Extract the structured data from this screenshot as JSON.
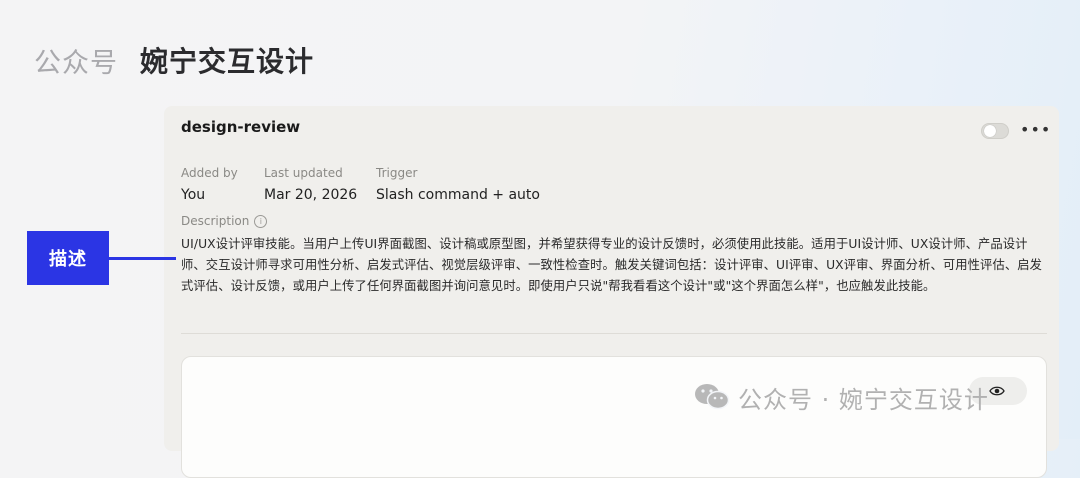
{
  "header": {
    "prefix": "公众号",
    "account": "婉宁交互设计"
  },
  "card": {
    "title": "design-review",
    "meta": [
      {
        "label": "Added by",
        "value": "You"
      },
      {
        "label": "Last updated",
        "value": "Mar 20, 2026"
      },
      {
        "label": "Trigger",
        "value": "Slash command + auto"
      }
    ],
    "description_label": "Description",
    "description": "UI/UX设计评审技能。当用户上传UI界面截图、设计稿或原型图，并希望获得专业的设计反馈时，必须使用此技能。适用于UI设计师、UX设计师、产品设计师、交互设计师寻求可用性分析、启发式评估、视觉层级评审、一致性检查时。触发关键词包括：设计评审、UI评审、UX评审、界面分析、可用性评估、启发式评估、设计反馈，或用户上传了任何界面截图并询问意见时。即使用户只说\"帮我看看这个设计\"或\"这个界面怎么样\"，也应触发此技能。"
  },
  "annotation": {
    "label": "描述"
  },
  "watermark": {
    "text": "公众号 · 婉宁交互设计"
  }
}
